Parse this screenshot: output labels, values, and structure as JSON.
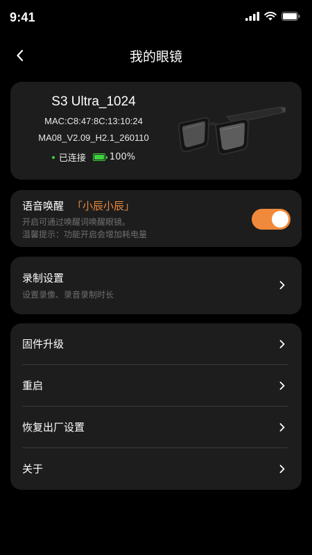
{
  "status_bar": {
    "time": "9:41"
  },
  "nav": {
    "title": "我的眼镜"
  },
  "device": {
    "name": "S3 Ultra_1024",
    "mac": "MAC:C8:47:8C:13:10:24",
    "firmware": "MA08_V2.09_H2.1_260110",
    "connection": "已连接",
    "battery": "100%"
  },
  "voice_wake": {
    "title": "语音唤醒",
    "keyword": "「小辰小辰」",
    "desc_line1": "开启可通过唤醒词唤醒眼镜。",
    "desc_line2": "温馨提示：功能开启会增加耗电量",
    "enabled": true
  },
  "record": {
    "title": "录制设置",
    "subtitle": "设置录像、录音录制时长"
  },
  "menu": {
    "items": [
      {
        "label": "固件升级"
      },
      {
        "label": "重启"
      },
      {
        "label": "恢复出厂设置"
      },
      {
        "label": "关于"
      }
    ]
  },
  "colors": {
    "accent": "#f08a3a",
    "battery": "#3fd13f",
    "card": "#1d1d1d"
  }
}
